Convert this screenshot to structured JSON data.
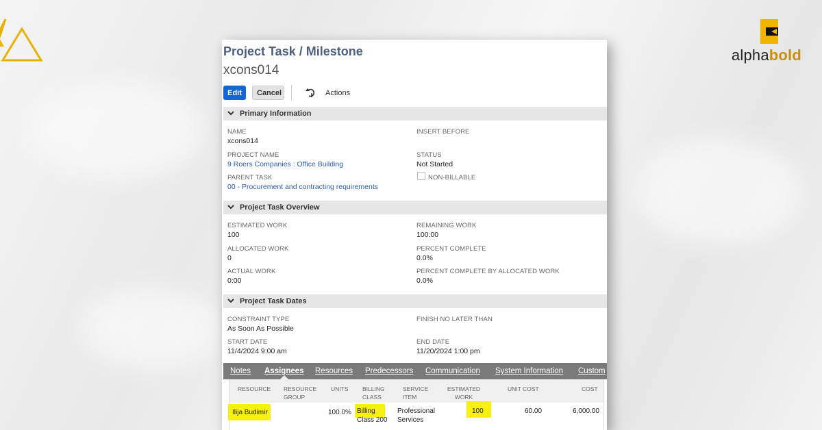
{
  "brand": {
    "name_part1": "alpha",
    "name_part2": "bold"
  },
  "record": {
    "type_title": "Project Task / Milestone",
    "name": "xcons014"
  },
  "toolbar": {
    "edit_label": "Edit",
    "cancel_label": "Cancel",
    "actions_label": "Actions"
  },
  "sections": {
    "primary": {
      "title": "Primary Information",
      "name_label": "NAME",
      "name_value": "xcons014",
      "insert_before_label": "INSERT BEFORE",
      "project_name_label": "PROJECT NAME",
      "project_name_value": "9 Roers Companies : Office Building",
      "status_label": "STATUS",
      "status_value": "Not Started",
      "parent_task_label": "PARENT TASK",
      "parent_task_value": "00 - Procurement and contracting requirements",
      "non_billable_label": "NON-BILLABLE"
    },
    "overview": {
      "title": "Project Task Overview",
      "estimated_work_label": "ESTIMATED WORK",
      "estimated_work_value": "100",
      "remaining_work_label": "REMAINING WORK",
      "remaining_work_value": "100:00",
      "allocated_work_label": "ALLOCATED WORK",
      "allocated_work_value": "0",
      "percent_complete_label": "PERCENT COMPLETE",
      "percent_complete_value": "0.0%",
      "actual_work_label": "ACTUAL WORK",
      "actual_work_value": "0:00",
      "pct_alloc_label": "PERCENT COMPLETE BY ALLOCATED WORK",
      "pct_alloc_value": "0.0%"
    },
    "dates": {
      "title": "Project Task Dates",
      "constraint_type_label": "CONSTRAINT TYPE",
      "constraint_type_value": "As Soon As Possible",
      "finish_no_later_label": "FINISH NO LATER THAN",
      "start_date_label": "START DATE",
      "start_date_value": "11/4/2024 9:00 am",
      "end_date_label": "END DATE",
      "end_date_value": "11/20/2024 1:00 pm"
    }
  },
  "subtabs": [
    "Notes",
    "Assignees",
    "Resources",
    "Predecessors",
    "Communication",
    "System Information",
    "Custom"
  ],
  "assignees": {
    "headers": {
      "resource": "RESOURCE",
      "resource_group_1": "RESOURCE",
      "resource_group_2": "GROUP",
      "units": "UNITS",
      "billing_class_1": "BILLING",
      "billing_class_2": "CLASS",
      "service_item_1": "SERVICE",
      "service_item_2": "ITEM",
      "estimated_work_1": "ESTIMATED",
      "estimated_work_2": "WORK",
      "unit_cost": "UNIT COST",
      "cost": "COST"
    },
    "row": {
      "resource": "Ilija Budimir",
      "units": "100.0%",
      "billing_class_1": "Billing",
      "billing_class_2": "Class 200",
      "service_item_1": "Professional",
      "service_item_2": "Services",
      "estimated_work": "100",
      "unit_cost": "60.00",
      "cost": "6,000.00"
    }
  },
  "colors": {
    "edit_button": "#1467d2",
    "highlight": "#f7f111",
    "brand_gold": "#c98f0a",
    "title_blue": "#4d5f7c"
  }
}
